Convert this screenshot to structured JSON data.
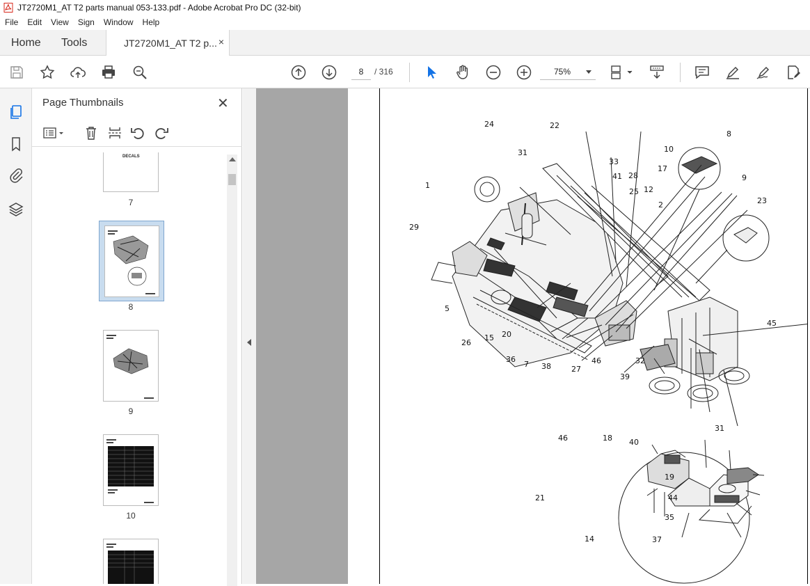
{
  "window": {
    "title": "JT2720M1_AT T2 parts manual 053-133.pdf - Adobe Acrobat Pro DC (32-bit)"
  },
  "menu": [
    "File",
    "Edit",
    "View",
    "Sign",
    "Window",
    "Help"
  ],
  "tabs": {
    "home": "Home",
    "tools": "Tools",
    "document": "JT2720M1_AT T2 p...",
    "close": "×"
  },
  "toolbar": {
    "current_page": "8",
    "page_total": "/ 316",
    "zoom": "75%"
  },
  "panel": {
    "title": "Page Thumbnails",
    "thumbnails": [
      {
        "label": "7",
        "caption": "DECALS"
      },
      {
        "label": "8"
      },
      {
        "label": "9"
      },
      {
        "label": "10"
      }
    ]
  },
  "callouts": [
    "24",
    "22",
    "31",
    "33",
    "41",
    "28",
    "25",
    "12",
    "2",
    "10",
    "17",
    "8",
    "9",
    "1",
    "29",
    "23",
    "5",
    "26",
    "15",
    "20",
    "36",
    "7",
    "38",
    "27",
    "46",
    "39",
    "32",
    "45",
    "31",
    "46",
    "18",
    "40",
    "19",
    "21",
    "44",
    "35",
    "14",
    "37"
  ],
  "colors": {
    "accent_blue": "#1473e6",
    "acrobat_red": "#d7281c",
    "doc_bg": "#a6a6a6"
  }
}
